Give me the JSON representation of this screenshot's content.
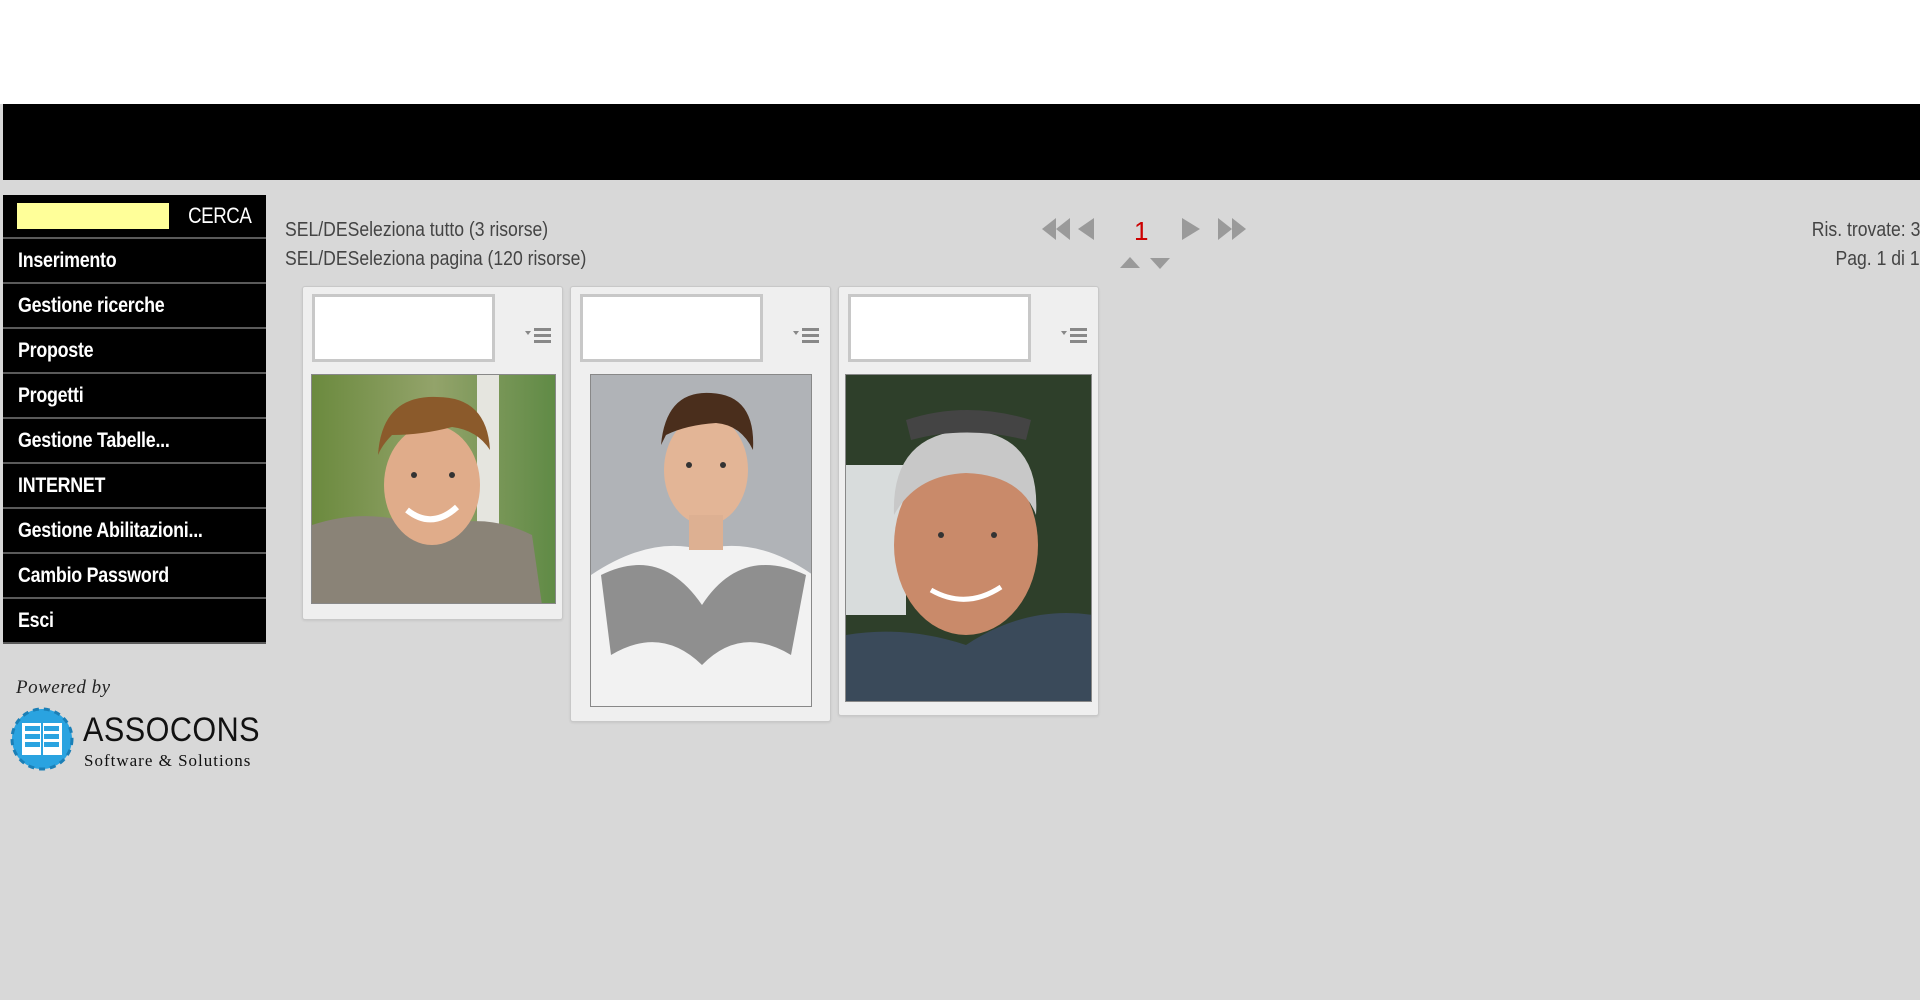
{
  "app": {
    "header": ""
  },
  "search": {
    "value": "",
    "button_label": "CERCA"
  },
  "sidebar": {
    "items": [
      {
        "label": "Inserimento"
      },
      {
        "label": "Gestione ricerche"
      },
      {
        "label": "Proposte"
      },
      {
        "label": "Progetti"
      },
      {
        "label": "Gestione Tabelle..."
      },
      {
        "label": "INTERNET"
      },
      {
        "label": "Gestione Abilitazioni..."
      },
      {
        "label": "Cambio Password"
      },
      {
        "label": "Esci"
      }
    ]
  },
  "branding": {
    "powered_by": "Powered by",
    "company": "ASSOCONS",
    "tagline": "Software & Solutions",
    "logo_color": "#2aa3e0"
  },
  "selection": {
    "select_all": "SEL/DESeleziona tutto (3 risorse)",
    "select_page": "SEL/DESeleziona pagina (120 risorse)"
  },
  "pagination": {
    "current_page": "1",
    "results_found": "Ris. trovate: 3",
    "page_of": "Pag. 1 di 1",
    "icons": [
      "first-page-icon",
      "prev-page-icon",
      "next-page-icon",
      "last-page-icon",
      "sort-up-icon",
      "sort-down-icon"
    ]
  },
  "results": [
    {
      "field_value": "",
      "photo": "smiling-teen-boy-outdoor"
    },
    {
      "field_value": "",
      "photo": "teen-boy-with-scarf"
    },
    {
      "field_value": "",
      "photo": "man-with-sunglasses-on-head"
    }
  ],
  "colors": {
    "background": "#d8d8d8",
    "header_bar": "#000000",
    "menu_bg": "#000000",
    "search_bg": "#ffff99",
    "page_number": "#cc0000"
  }
}
